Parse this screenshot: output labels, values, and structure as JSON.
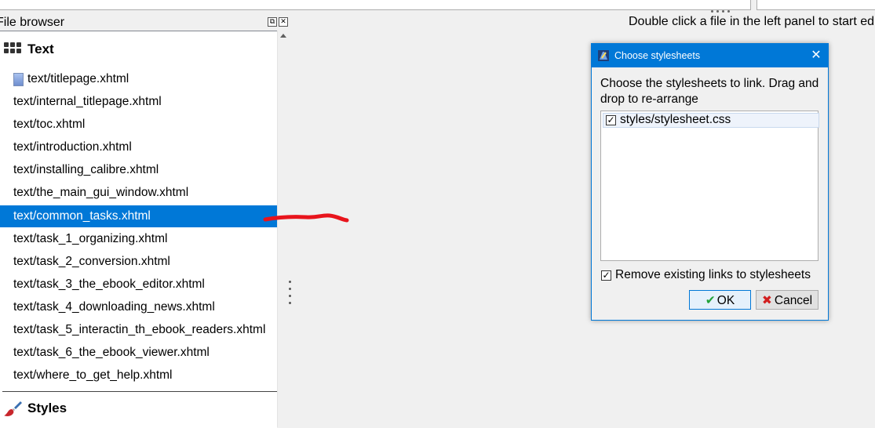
{
  "panel": {
    "title": "File browser",
    "float_button": "⧉",
    "close_button": "✕"
  },
  "tree": {
    "text_group": {
      "label": "Text",
      "icon": "text-grid-icon"
    },
    "files": [
      "text/titlepage.xhtml",
      "text/internal_titlepage.xhtml",
      "text/toc.xhtml",
      "text/introduction.xhtml",
      "text/installing_calibre.xhtml",
      "text/the_main_gui_window.xhtml",
      "text/common_tasks.xhtml",
      "text/task_1_organizing.xhtml",
      "text/task_2_conversion.xhtml",
      "text/task_3_the_ebook_editor.xhtml",
      "text/task_4_downloading_news.xhtml",
      "text/task_5_interactin_th_ebook_readers.xhtml",
      "text/task_6_the_ebook_viewer.xhtml",
      "text/where_to_get_help.xhtml"
    ],
    "selected_index": 6,
    "styles_group": {
      "label": "Styles",
      "icon": "paintbrush-icon"
    }
  },
  "main": {
    "hint": "Double click a file in the left panel to start edi"
  },
  "dialog": {
    "title": "Choose stylesheets",
    "message": "Choose the stylesheets to link. Drag and drop to re-arrange",
    "stylesheets": [
      {
        "name": "styles/stylesheet.css",
        "checked": true
      }
    ],
    "remove_existing_label": "Remove existing links to stylesheets",
    "remove_existing_checked": true,
    "ok_label": "OK",
    "cancel_label": "Cancel",
    "accent_color": "#0078d7"
  },
  "checkmark": "✓",
  "annotation_color": "#e8141c"
}
